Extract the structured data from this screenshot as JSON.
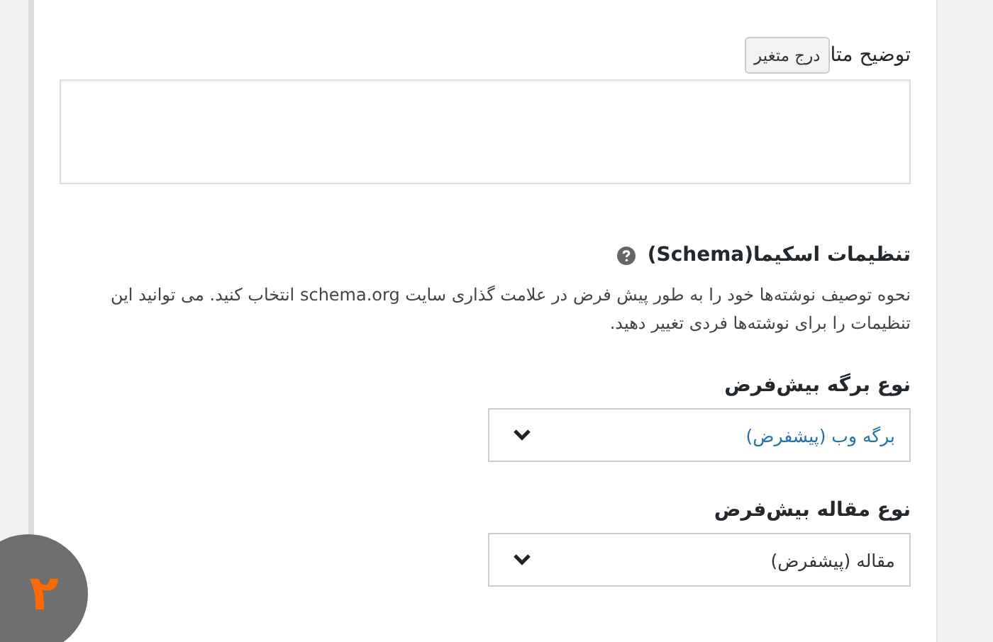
{
  "meta_description": {
    "label": "توضیح متا",
    "insert_variable_button": "درج متغیر"
  },
  "schema_settings": {
    "heading": "تنظیمات اسکیما(Schema)",
    "description": "نحوه توصیف نوشته‌ها خود را به طور پیش فرض در علامت گذاری سایت schema.org انتخاب کنید. می توانید این تنظیمات را برای نوشته‌ها فردی تغییر دهید."
  },
  "selects": [
    {
      "label": "نوع برگه بیش‌فرض",
      "value": "برگه وب (پیشفرض)",
      "highlighted": true
    },
    {
      "label": "نوع مقاله بیش‌فرض",
      "value": "مقاله (پیشفرض)",
      "highlighted": false
    }
  ],
  "step_badge": "۲"
}
